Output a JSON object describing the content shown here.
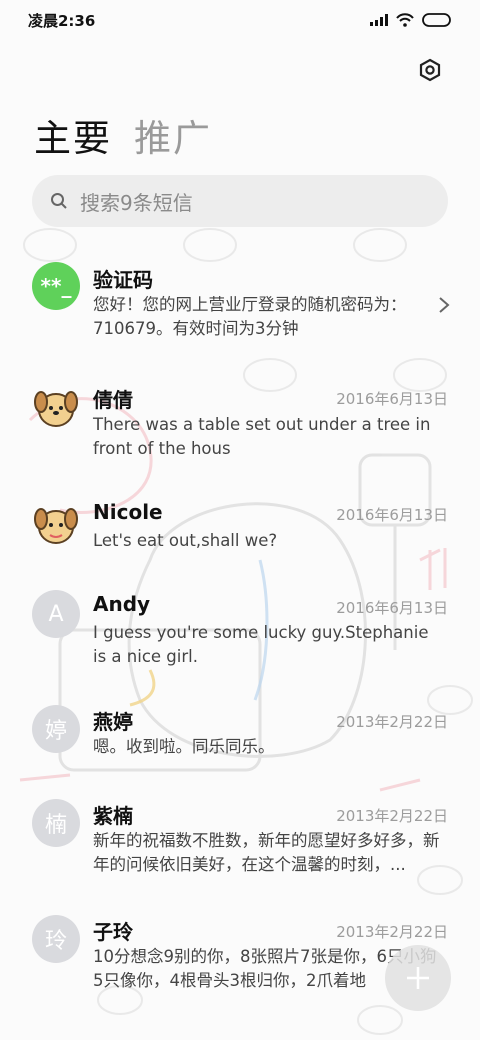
{
  "status_bar": {
    "time": "凌晨2:36"
  },
  "tabs": [
    {
      "label": "主要"
    },
    {
      "label": "推广"
    }
  ],
  "search": {
    "placeholder": "搜索9条短信"
  },
  "conversations": [
    {
      "name": "验证码",
      "avatar_text": "**_",
      "date": "",
      "snippet": "您好！您的网上营业厅登录的随机密码为：710679。有效时间为3分钟"
    },
    {
      "name": "倩倩",
      "avatar_text": "",
      "date": "2016年6月13日",
      "snippet": "There was a table set out under a tree in front of the hous"
    },
    {
      "name": "Nicole",
      "avatar_text": "",
      "date": "2016年6月13日",
      "snippet": "Let's eat out,shall we?"
    },
    {
      "name": "Andy",
      "avatar_text": "A",
      "date": "2016年6月13日",
      "snippet": "I guess you're some lucky guy.Stephanie is a nice girl."
    },
    {
      "name": "燕婷",
      "avatar_text": "婷",
      "date": "2013年2月22日",
      "snippet": "嗯。收到啦。同乐同乐。"
    },
    {
      "name": "紫楠",
      "avatar_text": "楠",
      "date": "2013年2月22日",
      "snippet": "新年的祝福数不胜数，新年的愿望好多好多，新年的问候依旧美好，在这个温馨的时刻，..."
    },
    {
      "name": "子玲",
      "avatar_text": "玲",
      "date": "2013年2月22日",
      "snippet": "10分想念9别的你，8张照片7张是你，6只小狗5只像你，4根骨头3根归你，2爪着地"
    }
  ],
  "icons": {
    "settings": "settings-icon",
    "search": "search-icon",
    "compose": "plus-icon"
  },
  "colors": {
    "verify_avatar": "#5fd15a",
    "default_avatar": "#d9dade"
  }
}
